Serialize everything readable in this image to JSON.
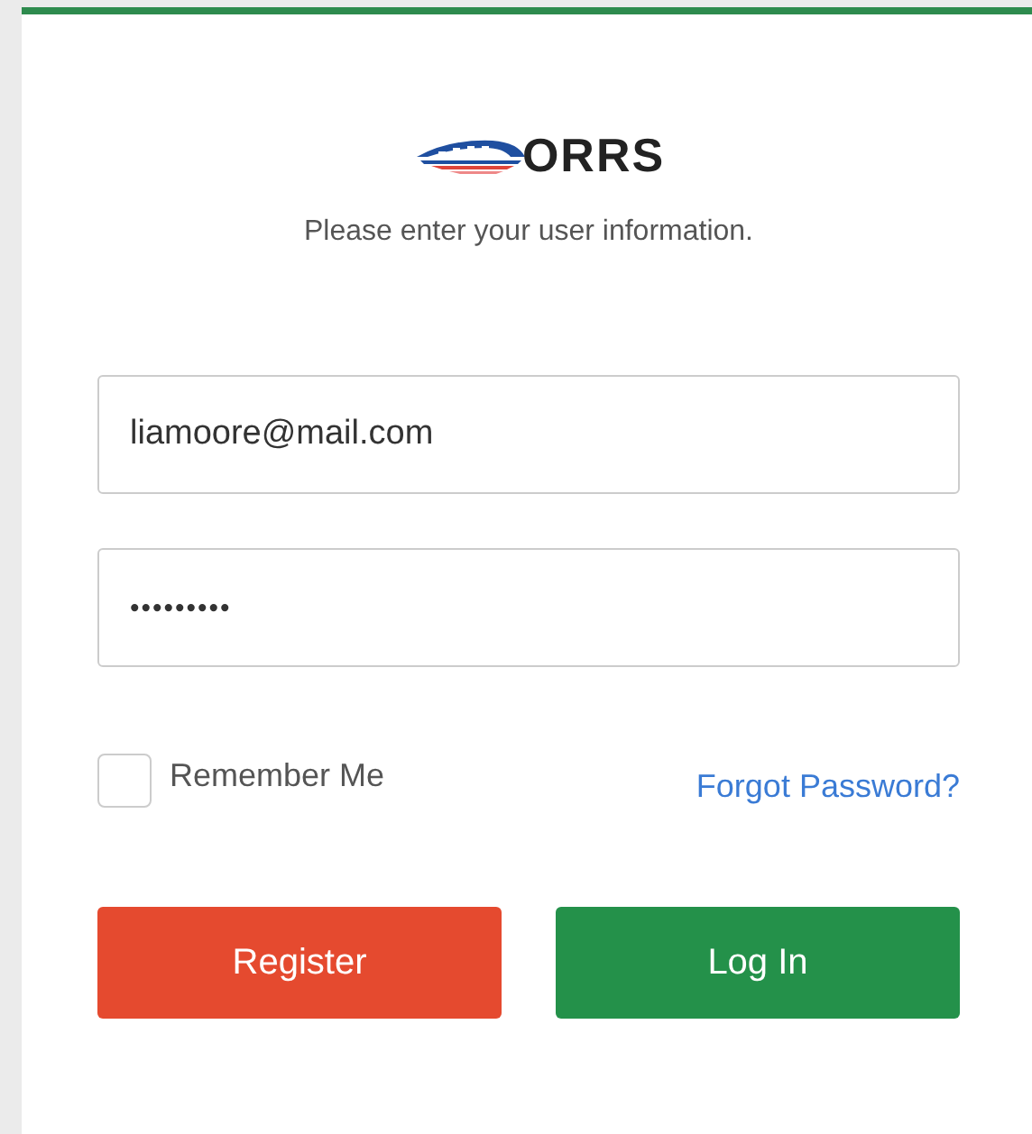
{
  "logo": {
    "text": "ORRS"
  },
  "prompt": "Please enter your user information.",
  "email_field": {
    "value": "liamoore@mail.com"
  },
  "password_field": {
    "value": "•••••••••"
  },
  "remember_me": {
    "label": "Remember Me",
    "checked": false
  },
  "forgot_link": "Forgot Password?",
  "buttons": [
    {
      "label": "Register",
      "kind": "danger"
    },
    {
      "label": "Log In",
      "kind": "primary"
    }
  ]
}
